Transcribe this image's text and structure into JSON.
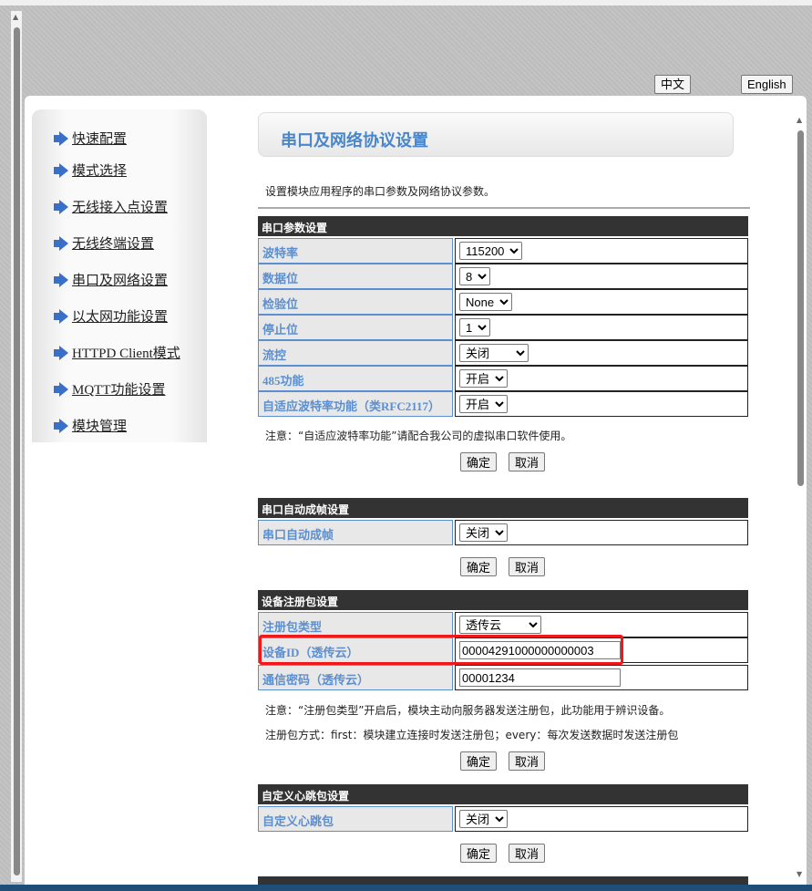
{
  "lang": {
    "zh": "中文",
    "en": "English"
  },
  "sidebar": {
    "items": [
      {
        "label": "快速配置"
      },
      {
        "label": "模式选择"
      },
      {
        "label": "无线接入点设置"
      },
      {
        "label": "无线终端设置"
      },
      {
        "label": "串口及网络设置"
      },
      {
        "label": "以太网功能设置"
      },
      {
        "label": "HTTPD Client模式"
      },
      {
        "label": "MQTT功能设置"
      },
      {
        "label": "模块管理"
      }
    ]
  },
  "page": {
    "title": "串口及网络协议设置",
    "description": "设置模块应用程序的串口参数及网络协议参数。"
  },
  "serial": {
    "header": "串口参数设置",
    "rows": [
      {
        "label": "波特率",
        "value": "115200"
      },
      {
        "label": "数据位",
        "value": "8"
      },
      {
        "label": "检验位",
        "value": "None"
      },
      {
        "label": "停止位",
        "value": "1"
      },
      {
        "label": "流控",
        "value": "关闭"
      },
      {
        "label": "485功能",
        "value": "开启"
      },
      {
        "label": "自适应波特率功能（类RFC2117）",
        "value": "开启"
      }
    ],
    "note": "注意：“自适应波特率功能”请配合我公司的虚拟串口软件使用。"
  },
  "autoframe": {
    "header": "串口自动成帧设置",
    "rows": [
      {
        "label": "串口自动成帧",
        "value": "关闭"
      }
    ]
  },
  "register": {
    "header": "设备注册包设置",
    "rows": [
      {
        "label": "注册包类型",
        "value": "透传云"
      },
      {
        "label": "设备ID（透传云）",
        "value": "00004291000000000003"
      },
      {
        "label": "通信密码（透传云）",
        "value": "00001234"
      }
    ],
    "note1": "注意：“注册包类型”开启后，模块主动向服务器发送注册包，此功能用于辨识设备。",
    "note2": "注册包方式：first：模块建立连接时发送注册包；every：每次发送数据时发送注册包"
  },
  "heartbeat": {
    "header": "自定义心跳包设置",
    "rows": [
      {
        "label": "自定义心跳包",
        "value": "关闭"
      }
    ]
  },
  "buttons": {
    "ok": "确定",
    "cancel": "取消"
  },
  "colors": {
    "accent": "#5b8fd0",
    "header_bg": "#333333",
    "highlight": "#f01818"
  }
}
